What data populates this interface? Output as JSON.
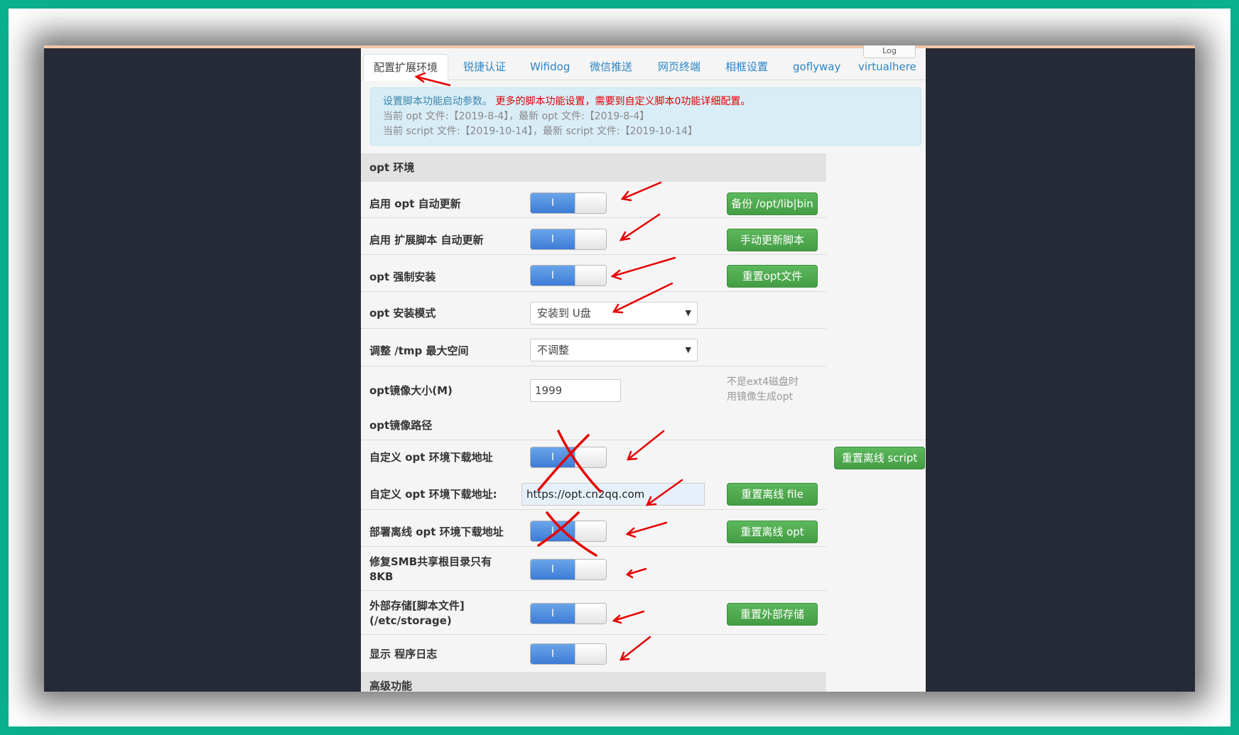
{
  "tabs": [
    "配置扩展环境",
    "锐捷认证",
    "Wifidog",
    "微信推送",
    "网页终端",
    "相框设置",
    "goflyway",
    "virtualhere"
  ],
  "log_button": "Log",
  "info": {
    "line1_part1": "设置脚本功能启动参数。",
    "line1_part2": "更多的脚本功能设置，需要到自定义脚本0功能详细配置。",
    "line2": "当前 opt 文件:【2019-8-4】，最新 opt 文件:【2019-8-4】",
    "line3": "当前 script 文件:【2019-10-14】，最新 script 文件:【2019-10-14】"
  },
  "sections": {
    "opt": "opt 环境",
    "advanced": "高级功能"
  },
  "rows": {
    "opt_auto_update": "启用 opt 自动更新",
    "script_auto_update": "启用 扩展脚本 自动更新",
    "opt_force_install": "opt 强制安装",
    "opt_install_mode": "opt 安装模式",
    "tmp_max_space": "调整 /tmp 最大空间",
    "opt_image_size": "opt镜像大小(M)",
    "opt_image_path": "opt镜像路径",
    "custom_opt_url_toggle": "自定义 opt 环境下载地址",
    "custom_opt_url_field": "自定义 opt 环境下载地址:",
    "deploy_offline_opt": "部署离线 opt 环境下载地址",
    "fix_smb_line1": "修复SMB共享根目录只有",
    "fix_smb_line2": "8KB",
    "external_storage_line1": "外部存储[脚本文件]",
    "external_storage_line2": "(/etc/storage)",
    "show_program_log": "显示 程序日志"
  },
  "toggle_on_label": "I",
  "selects": {
    "install_mode": "安装到 U盘",
    "tmp_space": "不调整"
  },
  "inputs": {
    "image_size": "1999",
    "custom_url": "https://opt.cn2qq.com"
  },
  "buttons": {
    "backup": "备份 /opt/lib|bin",
    "manual_update": "手动更新脚本",
    "reset_opt_files": "重置opt文件",
    "reset_offline_script": "重置离线 script",
    "reset_offline_file": "重置离线 file",
    "reset_offline_opt": "重置离线 opt",
    "reset_external_storage": "重置外部存储"
  },
  "note": {
    "line1": "不是ext4磁盘时",
    "line2": "用镜像生成opt"
  },
  "colors": {
    "frame": "#0bb08f",
    "tab_link": "#2b86c6",
    "toggle_on": "#4a8ae0",
    "button_green": "#5cb85c",
    "annotation": "#e60000"
  }
}
